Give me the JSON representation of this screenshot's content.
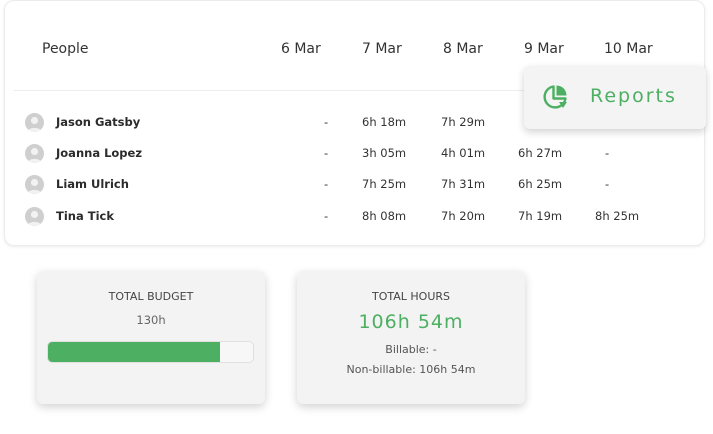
{
  "table": {
    "people_header": "People",
    "dates": [
      "6 Mar",
      "7 Mar",
      "8 Mar",
      "9 Mar",
      "10 Mar"
    ],
    "rows": [
      {
        "name": "Jason Gatsby",
        "cells": [
          "-",
          "6h 18m",
          "7h 29m",
          "",
          ""
        ]
      },
      {
        "name": "Joanna Lopez",
        "cells": [
          "-",
          "3h 05m",
          "4h 01m",
          "6h 27m",
          "-"
        ]
      },
      {
        "name": "Liam Ulrich",
        "cells": [
          "-",
          "7h 25m",
          "7h 31m",
          "6h 25m",
          "-"
        ]
      },
      {
        "name": "Tina Tick",
        "cells": [
          "-",
          "8h 08m",
          "7h 20m",
          "7h 19m",
          "8h 25m"
        ]
      }
    ]
  },
  "reports": {
    "label": "Reports",
    "icon": "pie-chart-icon"
  },
  "budget": {
    "title": "TOTAL BUDGET",
    "value": "130h",
    "progress_fraction": 0.84
  },
  "hours": {
    "title": "TOTAL HOURS",
    "value": "106h 54m",
    "billable": "Billable: -",
    "non_billable": "Non-billable: 106h 54m"
  },
  "colors": {
    "accent": "#4caf62",
    "avatar": "#cfcfcf"
  }
}
